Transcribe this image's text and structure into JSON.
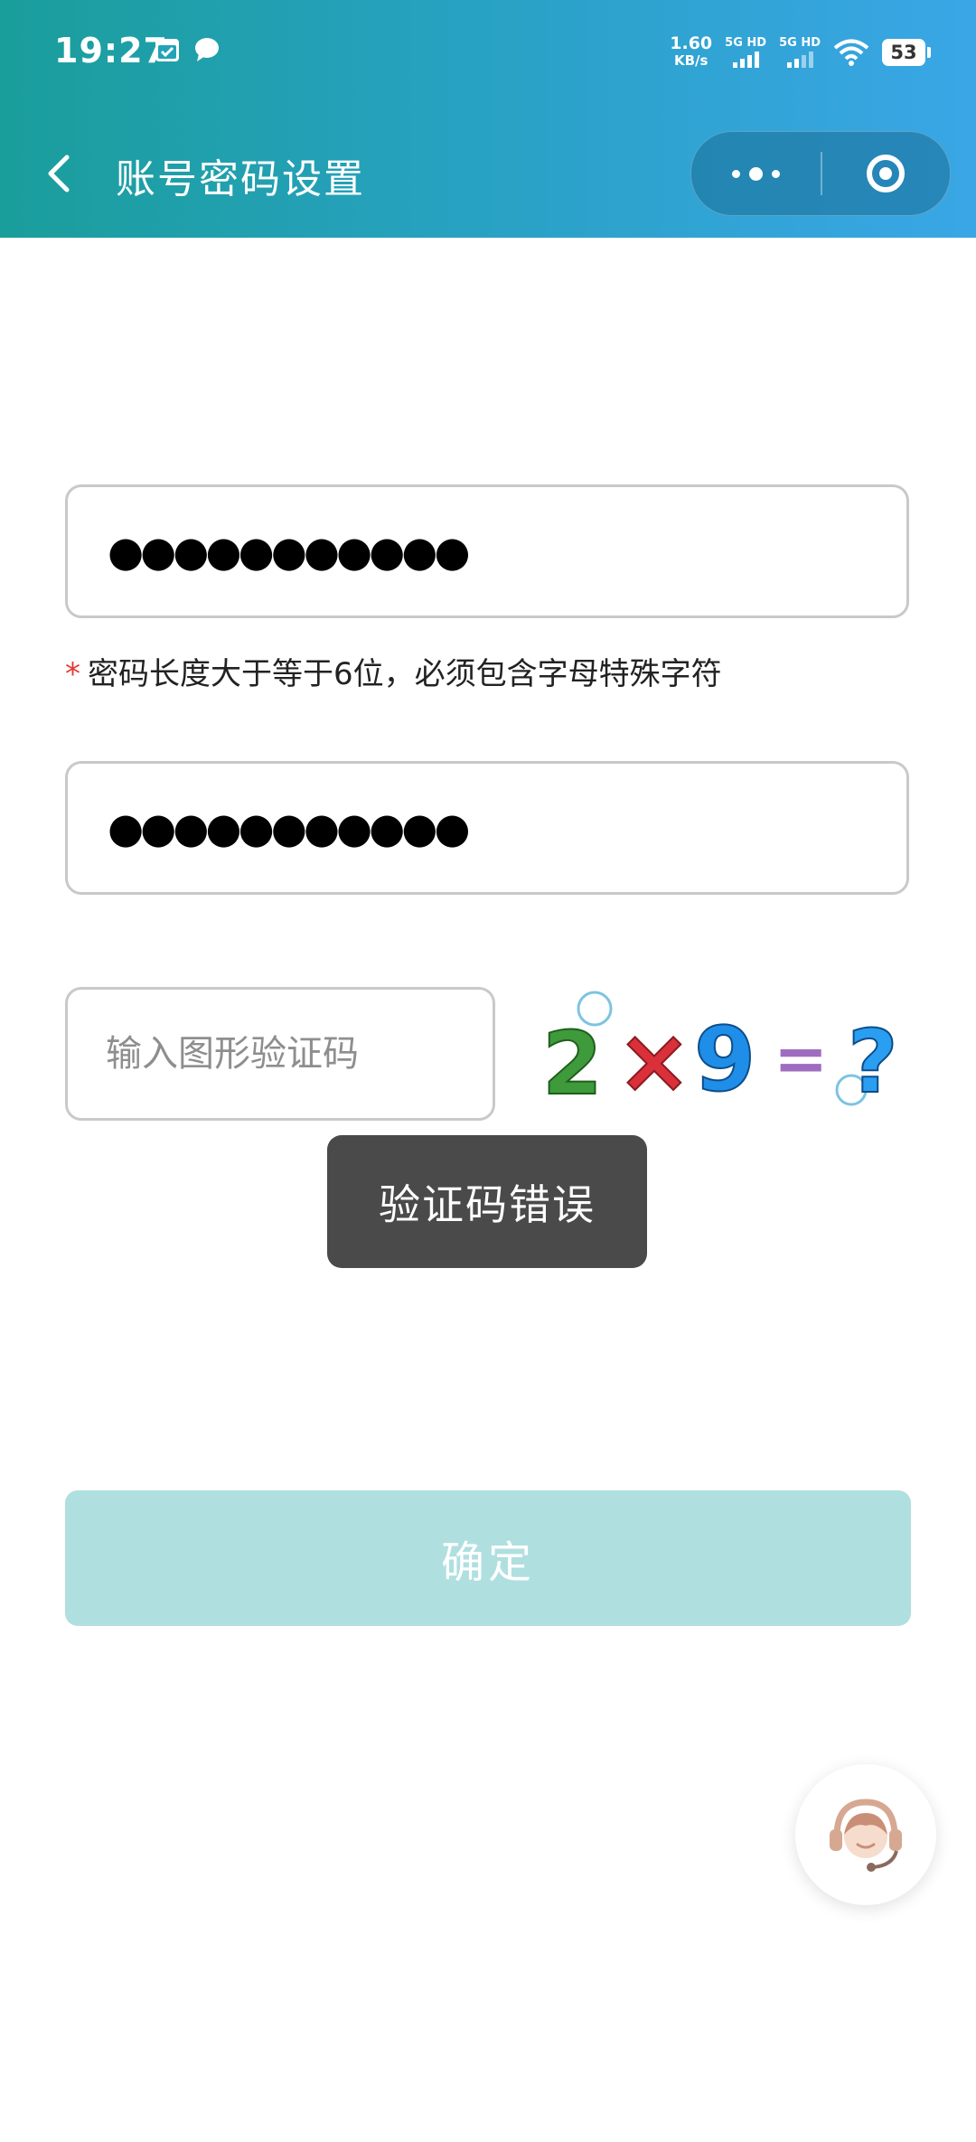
{
  "status_bar": {
    "time": "19:27",
    "net_speed_value": "1.60",
    "net_speed_unit": "KB/s",
    "sim1_label": "5G HD",
    "sim2_label": "5G HD",
    "battery": "53",
    "icons": [
      "calendar-check-icon",
      "chat-bubble-icon",
      "wifi-icon"
    ]
  },
  "nav": {
    "title": "账号密码设置",
    "back_icon": "chevron-left-icon",
    "more_icon": "more-dots-icon",
    "close_icon": "target-circle-icon"
  },
  "form": {
    "password_value": "●●●●●●●●●●●",
    "confirm_password_value": "●●●●●●●●●●●",
    "hint_star": "*",
    "hint_text": "密码长度大于等于6位，必须包含字母特殊字符",
    "captcha_placeholder": "输入图形验证码",
    "captcha_image": {
      "left_operand": "2",
      "operator": "×",
      "right_operand": "9",
      "equals": "=",
      "result": "?"
    },
    "confirm_label": "确定"
  },
  "toast": {
    "message": "验证码错误"
  },
  "floating": {
    "service_icon": "customer-service-headset-icon"
  },
  "colors": {
    "header_start": "#1a9e9b",
    "header_end": "#3aa6e6",
    "confirm_button": "#b0dfe0",
    "hint_star": "#e53935",
    "toast_bg": "#4a4a4a"
  }
}
